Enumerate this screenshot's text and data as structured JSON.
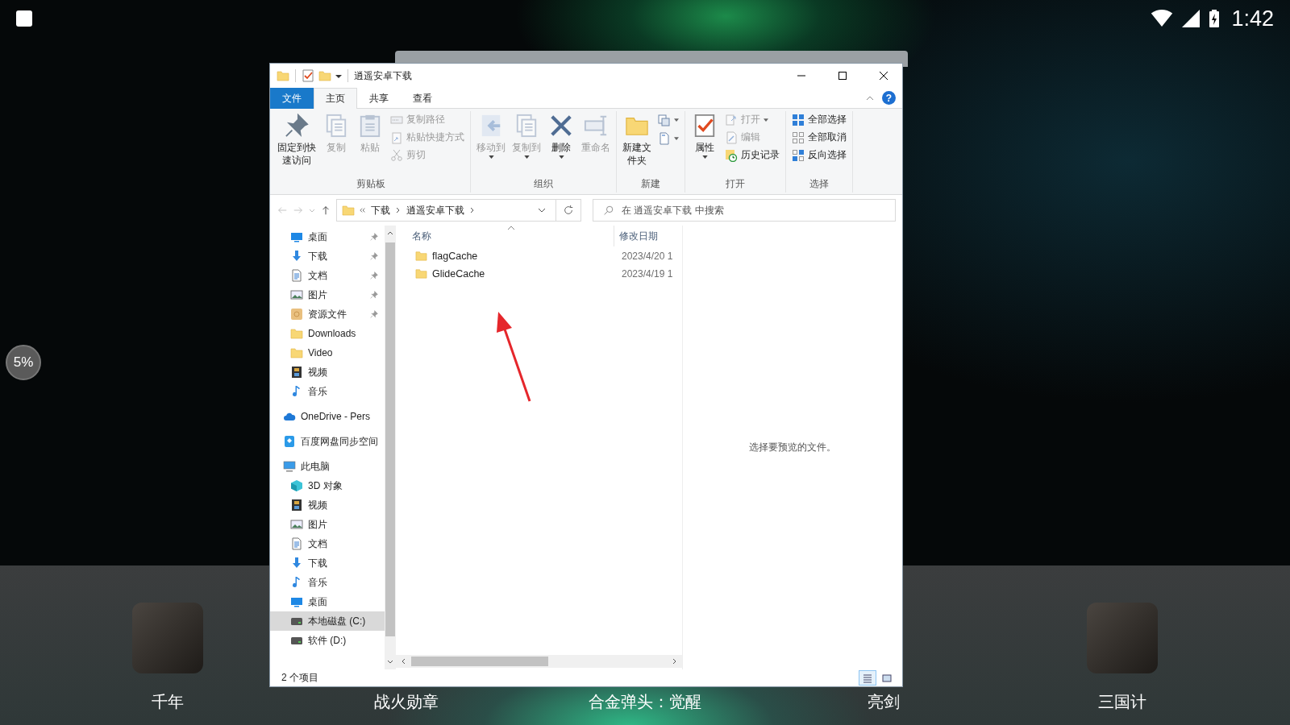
{
  "status_bar": {
    "time": "1:42"
  },
  "side_widget": {
    "text": "5%"
  },
  "window": {
    "title": "逍遥安卓下载",
    "tabs": [
      {
        "label": "文件",
        "kind": "file",
        "selected": false
      },
      {
        "label": "主页",
        "kind": "tab",
        "selected": true
      },
      {
        "label": "共享",
        "kind": "tab",
        "selected": false
      },
      {
        "label": "查看",
        "kind": "tab",
        "selected": false
      }
    ],
    "help": "?",
    "ribbon": [
      {
        "label": "剪贴板",
        "large": [
          {
            "label": "固定到快速访问",
            "kind": "pin",
            "disabled": false,
            "dropdown": false
          },
          {
            "label": "复制",
            "kind": "copy",
            "disabled": true,
            "dropdown": false
          },
          {
            "label": "粘贴",
            "kind": "clipboard",
            "disabled": true,
            "dropdown": false
          }
        ],
        "small": [
          {
            "label": "复制路径",
            "kind": "path",
            "disabled": true,
            "dropdown": false
          },
          {
            "label": "粘贴快捷方式",
            "kind": "shortcut",
            "disabled": true,
            "dropdown": false
          },
          {
            "label": "剪切",
            "kind": "scissors",
            "disabled": true,
            "dropdown": false
          }
        ]
      },
      {
        "label": "组织",
        "large": [
          {
            "label": "移动到",
            "kind": "move",
            "disabled": true,
            "dropdown": true
          },
          {
            "label": "复制到",
            "kind": "copy",
            "disabled": true,
            "dropdown": true
          },
          {
            "label": "删除",
            "kind": "delete",
            "disabled": false,
            "dropdown": true
          },
          {
            "label": "重命名",
            "kind": "rename",
            "disabled": true,
            "dropdown": false
          }
        ]
      },
      {
        "label": "新建",
        "large": [
          {
            "label": "新建文件夹",
            "kind": "folder",
            "disabled": false,
            "dropdown": false
          }
        ],
        "small": [
          {
            "kind": "newitem",
            "disabled": false,
            "dropdown": true
          },
          {
            "kind": "easyaccess",
            "disabled": false,
            "dropdown": true
          }
        ]
      },
      {
        "label": "打开",
        "large": [
          {
            "label": "属性",
            "kind": "properties",
            "disabled": false,
            "dropdown": true
          }
        ],
        "small": [
          {
            "label": "打开",
            "kind": "open",
            "disabled": true,
            "dropdown": true
          },
          {
            "label": "编辑",
            "kind": "edit",
            "disabled": true,
            "dropdown": false
          },
          {
            "label": "历史记录",
            "kind": "history",
            "disabled": false,
            "dropdown": false
          }
        ]
      },
      {
        "label": "选择",
        "small": [
          {
            "label": "全部选择",
            "kind": "selectall",
            "disabled": false,
            "dropdown": false
          },
          {
            "label": "全部取消",
            "kind": "selectnone",
            "disabled": false,
            "dropdown": false
          },
          {
            "label": "反向选择",
            "kind": "invert",
            "disabled": false,
            "dropdown": false
          }
        ]
      }
    ],
    "address": {
      "crumbs": [
        "下载",
        "逍遥安卓下载"
      ],
      "search_placeholder": "在 逍遥安卓下载 中搜索"
    },
    "nav_tree": [
      {
        "kind": "group",
        "children": [
          {
            "label": "桌面",
            "kind": "desktop",
            "pinned": true,
            "selected": false
          },
          {
            "label": "下载",
            "kind": "download",
            "pinned": true,
            "selected": false
          },
          {
            "label": "文档",
            "kind": "document",
            "pinned": true,
            "selected": false
          },
          {
            "label": "图片",
            "kind": "picture",
            "pinned": true,
            "selected": false
          },
          {
            "label": "资源文件",
            "kind": "library",
            "pinned": true,
            "selected": false
          },
          {
            "label": "Downloads",
            "kind": "folder",
            "pinned": false,
            "selected": false
          },
          {
            "label": "Video",
            "kind": "folder",
            "pinned": false,
            "selected": false
          },
          {
            "label": "视频",
            "kind": "video",
            "pinned": false,
            "selected": false
          },
          {
            "label": "音乐",
            "kind": "music",
            "pinned": false,
            "selected": false
          }
        ]
      },
      {
        "label": "OneDrive - Pers",
        "kind": "cloud",
        "selected": false
      },
      {
        "label": "百度网盘同步空间",
        "kind": "sync",
        "selected": false
      },
      {
        "label": "此电脑",
        "kind": "computer",
        "selected": false,
        "children": [
          {
            "label": "3D 对象",
            "kind": "objects",
            "selected": false
          },
          {
            "label": "视频",
            "kind": "video",
            "selected": false
          },
          {
            "label": "图片",
            "kind": "picture",
            "selected": false
          },
          {
            "label": "文档",
            "kind": "document",
            "selected": false
          },
          {
            "label": "下载",
            "kind": "download",
            "selected": false
          },
          {
            "label": "音乐",
            "kind": "music",
            "selected": false
          },
          {
            "label": "桌面",
            "kind": "desktop",
            "selected": false
          },
          {
            "label": "本地磁盘 (C:)",
            "kind": "drive",
            "selected": true
          },
          {
            "label": "软件 (D:)",
            "kind": "drive",
            "selected": false
          }
        ]
      }
    ],
    "columns": [
      "名称",
      "修改日期"
    ],
    "files": [
      {
        "name": "flagCache",
        "modified": "2023/4/20 1"
      },
      {
        "name": "GlideCache",
        "modified": "2023/4/19 1"
      }
    ],
    "preview_text": "选择要预览的文件。",
    "item_count": "2 个项目",
    "views": [
      {
        "kind": "details",
        "selected": true
      },
      {
        "kind": "large",
        "selected": false
      }
    ]
  },
  "dock": [
    {
      "label": "千年",
      "icon_visible": true
    },
    {
      "label": "战火勋章",
      "icon_visible": false
    },
    {
      "label": "合金弹头：觉醒",
      "icon_visible": false
    },
    {
      "label": "亮剑",
      "icon_visible": false
    },
    {
      "label": "三国计",
      "icon_visible": true
    }
  ]
}
